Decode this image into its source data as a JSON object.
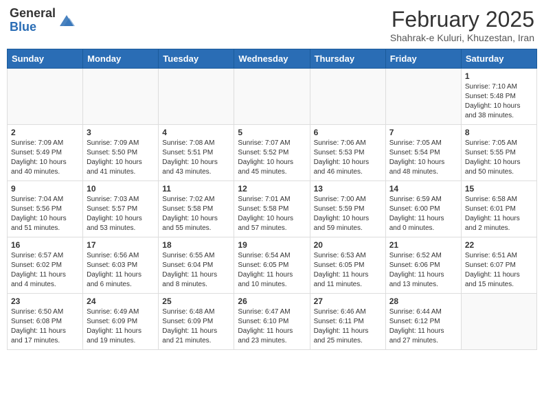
{
  "header": {
    "logo_line1": "General",
    "logo_line2": "Blue",
    "month": "February 2025",
    "location": "Shahrak-e Kuluri, Khuzestan, Iran"
  },
  "days_of_week": [
    "Sunday",
    "Monday",
    "Tuesday",
    "Wednesday",
    "Thursday",
    "Friday",
    "Saturday"
  ],
  "weeks": [
    [
      {
        "day": "",
        "info": ""
      },
      {
        "day": "",
        "info": ""
      },
      {
        "day": "",
        "info": ""
      },
      {
        "day": "",
        "info": ""
      },
      {
        "day": "",
        "info": ""
      },
      {
        "day": "",
        "info": ""
      },
      {
        "day": "1",
        "info": "Sunrise: 7:10 AM\nSunset: 5:48 PM\nDaylight: 10 hours and 38 minutes."
      }
    ],
    [
      {
        "day": "2",
        "info": "Sunrise: 7:09 AM\nSunset: 5:49 PM\nDaylight: 10 hours and 40 minutes."
      },
      {
        "day": "3",
        "info": "Sunrise: 7:09 AM\nSunset: 5:50 PM\nDaylight: 10 hours and 41 minutes."
      },
      {
        "day": "4",
        "info": "Sunrise: 7:08 AM\nSunset: 5:51 PM\nDaylight: 10 hours and 43 minutes."
      },
      {
        "day": "5",
        "info": "Sunrise: 7:07 AM\nSunset: 5:52 PM\nDaylight: 10 hours and 45 minutes."
      },
      {
        "day": "6",
        "info": "Sunrise: 7:06 AM\nSunset: 5:53 PM\nDaylight: 10 hours and 46 minutes."
      },
      {
        "day": "7",
        "info": "Sunrise: 7:05 AM\nSunset: 5:54 PM\nDaylight: 10 hours and 48 minutes."
      },
      {
        "day": "8",
        "info": "Sunrise: 7:05 AM\nSunset: 5:55 PM\nDaylight: 10 hours and 50 minutes."
      }
    ],
    [
      {
        "day": "9",
        "info": "Sunrise: 7:04 AM\nSunset: 5:56 PM\nDaylight: 10 hours and 51 minutes."
      },
      {
        "day": "10",
        "info": "Sunrise: 7:03 AM\nSunset: 5:57 PM\nDaylight: 10 hours and 53 minutes."
      },
      {
        "day": "11",
        "info": "Sunrise: 7:02 AM\nSunset: 5:58 PM\nDaylight: 10 hours and 55 minutes."
      },
      {
        "day": "12",
        "info": "Sunrise: 7:01 AM\nSunset: 5:58 PM\nDaylight: 10 hours and 57 minutes."
      },
      {
        "day": "13",
        "info": "Sunrise: 7:00 AM\nSunset: 5:59 PM\nDaylight: 10 hours and 59 minutes."
      },
      {
        "day": "14",
        "info": "Sunrise: 6:59 AM\nSunset: 6:00 PM\nDaylight: 11 hours and 0 minutes."
      },
      {
        "day": "15",
        "info": "Sunrise: 6:58 AM\nSunset: 6:01 PM\nDaylight: 11 hours and 2 minutes."
      }
    ],
    [
      {
        "day": "16",
        "info": "Sunrise: 6:57 AM\nSunset: 6:02 PM\nDaylight: 11 hours and 4 minutes."
      },
      {
        "day": "17",
        "info": "Sunrise: 6:56 AM\nSunset: 6:03 PM\nDaylight: 11 hours and 6 minutes."
      },
      {
        "day": "18",
        "info": "Sunrise: 6:55 AM\nSunset: 6:04 PM\nDaylight: 11 hours and 8 minutes."
      },
      {
        "day": "19",
        "info": "Sunrise: 6:54 AM\nSunset: 6:05 PM\nDaylight: 11 hours and 10 minutes."
      },
      {
        "day": "20",
        "info": "Sunrise: 6:53 AM\nSunset: 6:05 PM\nDaylight: 11 hours and 11 minutes."
      },
      {
        "day": "21",
        "info": "Sunrise: 6:52 AM\nSunset: 6:06 PM\nDaylight: 11 hours and 13 minutes."
      },
      {
        "day": "22",
        "info": "Sunrise: 6:51 AM\nSunset: 6:07 PM\nDaylight: 11 hours and 15 minutes."
      }
    ],
    [
      {
        "day": "23",
        "info": "Sunrise: 6:50 AM\nSunset: 6:08 PM\nDaylight: 11 hours and 17 minutes."
      },
      {
        "day": "24",
        "info": "Sunrise: 6:49 AM\nSunset: 6:09 PM\nDaylight: 11 hours and 19 minutes."
      },
      {
        "day": "25",
        "info": "Sunrise: 6:48 AM\nSunset: 6:09 PM\nDaylight: 11 hours and 21 minutes."
      },
      {
        "day": "26",
        "info": "Sunrise: 6:47 AM\nSunset: 6:10 PM\nDaylight: 11 hours and 23 minutes."
      },
      {
        "day": "27",
        "info": "Sunrise: 6:46 AM\nSunset: 6:11 PM\nDaylight: 11 hours and 25 minutes."
      },
      {
        "day": "28",
        "info": "Sunrise: 6:44 AM\nSunset: 6:12 PM\nDaylight: 11 hours and 27 minutes."
      },
      {
        "day": "",
        "info": ""
      }
    ]
  ]
}
